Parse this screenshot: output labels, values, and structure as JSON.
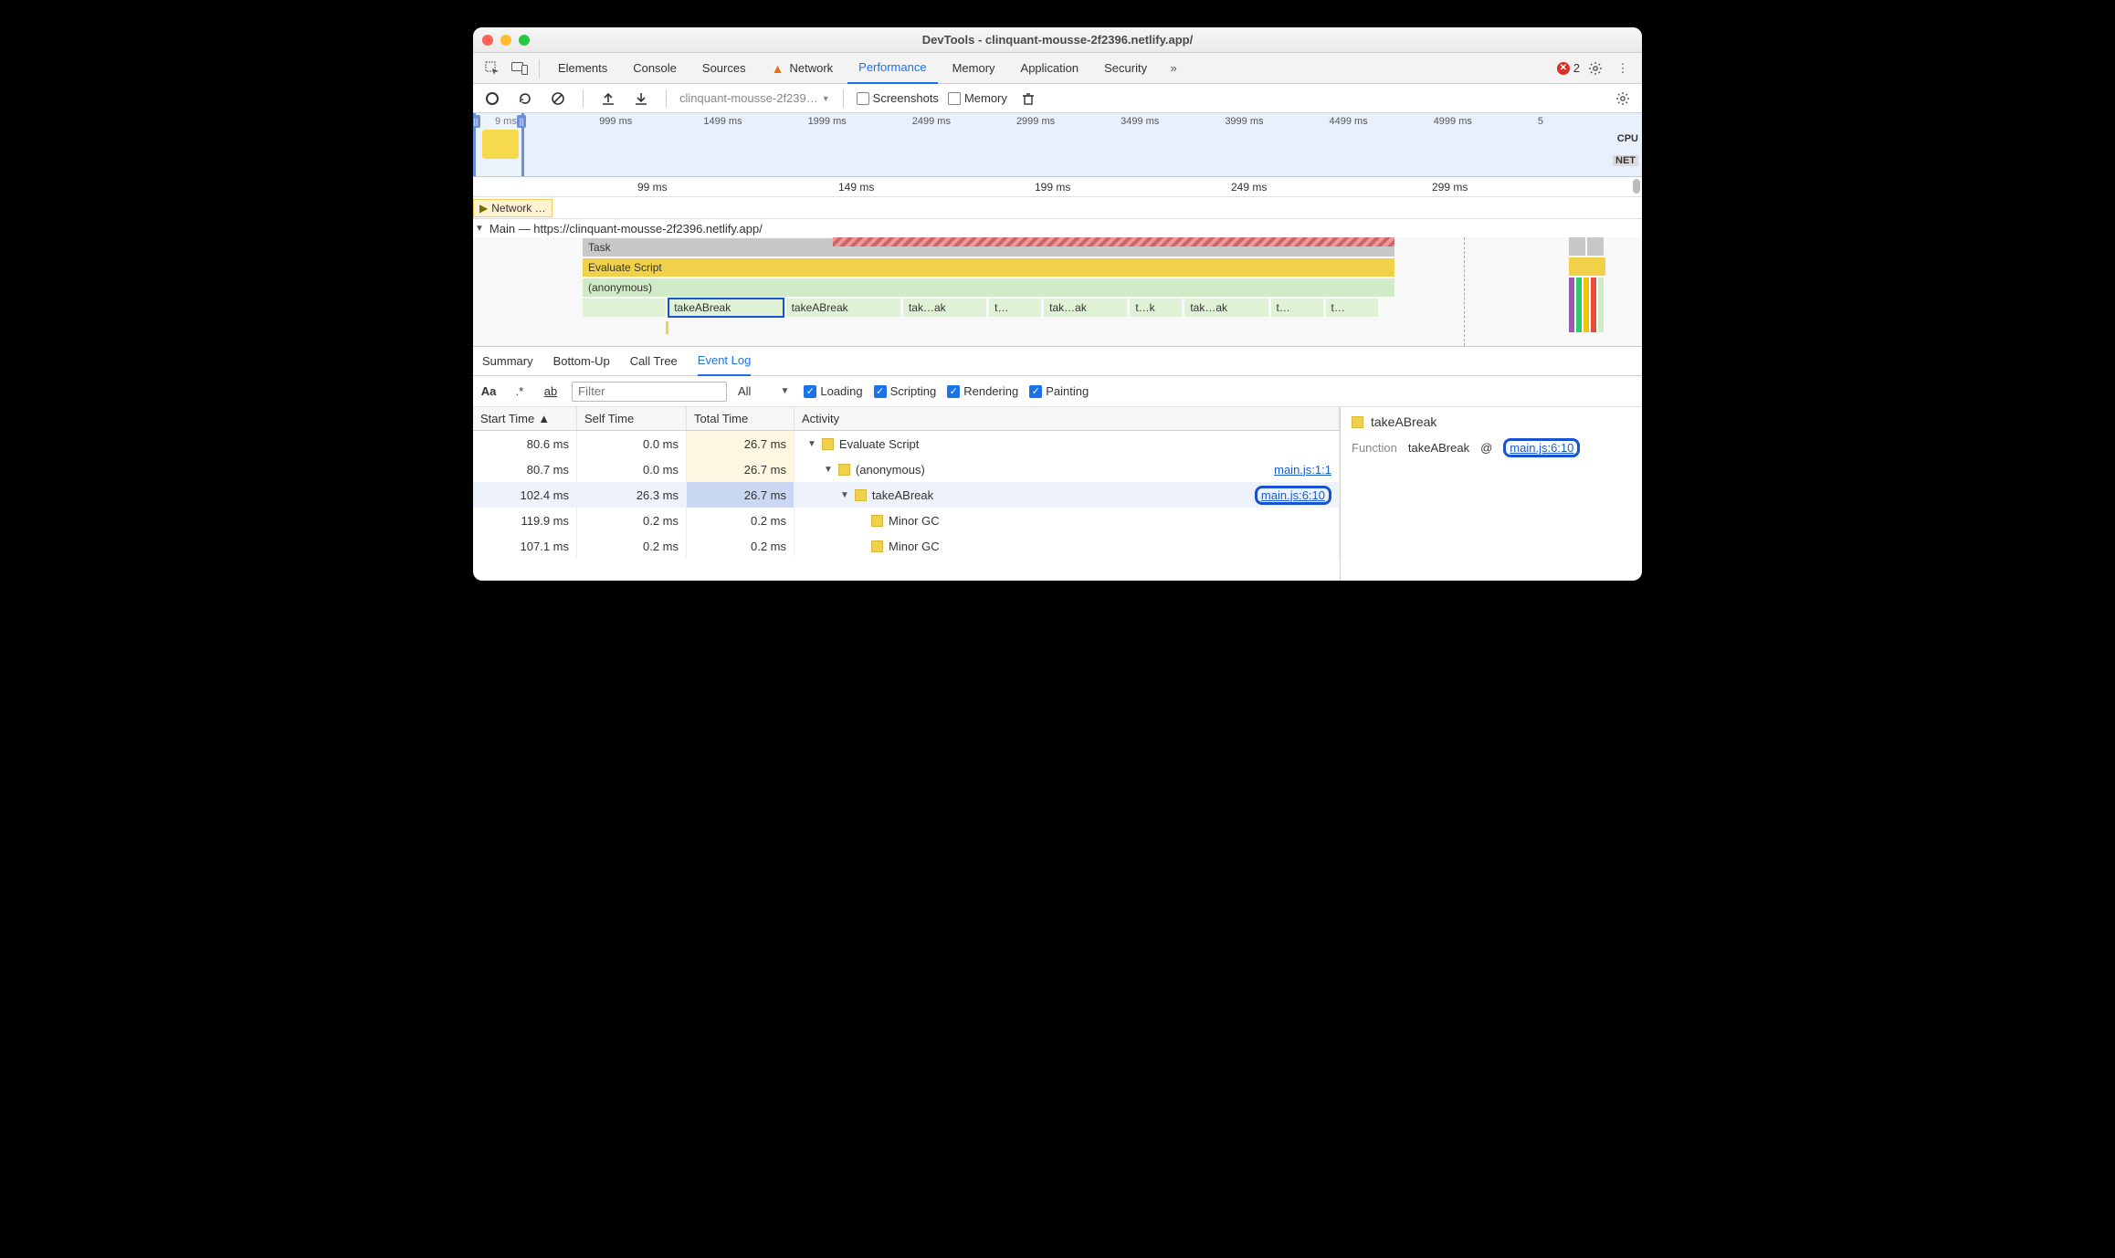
{
  "window": {
    "title": "DevTools - clinquant-mousse-2f2396.netlify.app/"
  },
  "mainTabs": {
    "elements": "Elements",
    "console": "Console",
    "sources": "Sources",
    "network": "Network",
    "performance": "Performance",
    "memory": "Memory",
    "application": "Application",
    "security": "Security",
    "errorCount": "2"
  },
  "toolbar": {
    "recording": "clinquant-mousse-2f239…",
    "screenshots": "Screenshots",
    "memory": "Memory"
  },
  "overview": {
    "ticks": [
      "9 ms",
      "999 ms",
      "1499 ms",
      "1999 ms",
      "2499 ms",
      "2999 ms",
      "3499 ms",
      "3999 ms",
      "4499 ms",
      "4999 ms",
      "5"
    ],
    "cpu": "CPU",
    "net": "NET"
  },
  "ruler2": {
    "t99": "99 ms",
    "t149": "149 ms",
    "t199": "199 ms",
    "t249": "249 ms",
    "t299": "299 ms"
  },
  "netstrip": {
    "label": "Network …"
  },
  "main": {
    "label": "Main — https://clinquant-mousse-2f2396.netlify.app/",
    "task": "Task",
    "eval": "Evaluate Script",
    "anon": "(anonymous)",
    "calls": [
      "takeABreak",
      "takeABreak",
      "tak…ak",
      "t…",
      "tak…ak",
      "t…k",
      "tak…ak",
      "t…",
      "t…"
    ]
  },
  "detailTabs": {
    "summary": "Summary",
    "bottom": "Bottom-Up",
    "call": "Call Tree",
    "eventlog": "Event Log"
  },
  "filter": {
    "placeholder": "Filter",
    "all": "All",
    "loading": "Loading",
    "scripting": "Scripting",
    "rendering": "Rendering",
    "painting": "Painting"
  },
  "table": {
    "headers": {
      "start": "Start Time",
      "self": "Self Time",
      "total": "Total Time",
      "activity": "Activity"
    },
    "rows": [
      {
        "start": "80.6 ms",
        "self": "0.0 ms",
        "total": "26.7 ms",
        "shade": "shade1",
        "indent": 0,
        "toggle": true,
        "label": "Evaluate Script",
        "src": ""
      },
      {
        "start": "80.7 ms",
        "self": "0.0 ms",
        "total": "26.7 ms",
        "shade": "shade1",
        "indent": 1,
        "toggle": true,
        "label": "(anonymous)",
        "src": "main.js:1:1",
        "boxed": false
      },
      {
        "start": "102.4 ms",
        "self": "26.3 ms",
        "total": "26.7 ms",
        "shade": "shade2",
        "indent": 2,
        "toggle": true,
        "label": "takeABreak",
        "src": "main.js:6:10",
        "boxed": true,
        "sel": true
      },
      {
        "start": "119.9 ms",
        "self": "0.2 ms",
        "total": "0.2 ms",
        "shade": "",
        "indent": 3,
        "toggle": false,
        "label": "Minor GC",
        "src": ""
      },
      {
        "start": "107.1 ms",
        "self": "0.2 ms",
        "total": "0.2 ms",
        "shade": "",
        "indent": 3,
        "toggle": false,
        "label": "Minor GC",
        "src": ""
      }
    ]
  },
  "sidepane": {
    "title": "takeABreak",
    "fnLabel": "Function",
    "fnName": "takeABreak",
    "at": "@",
    "src": "main.js:6:10"
  }
}
